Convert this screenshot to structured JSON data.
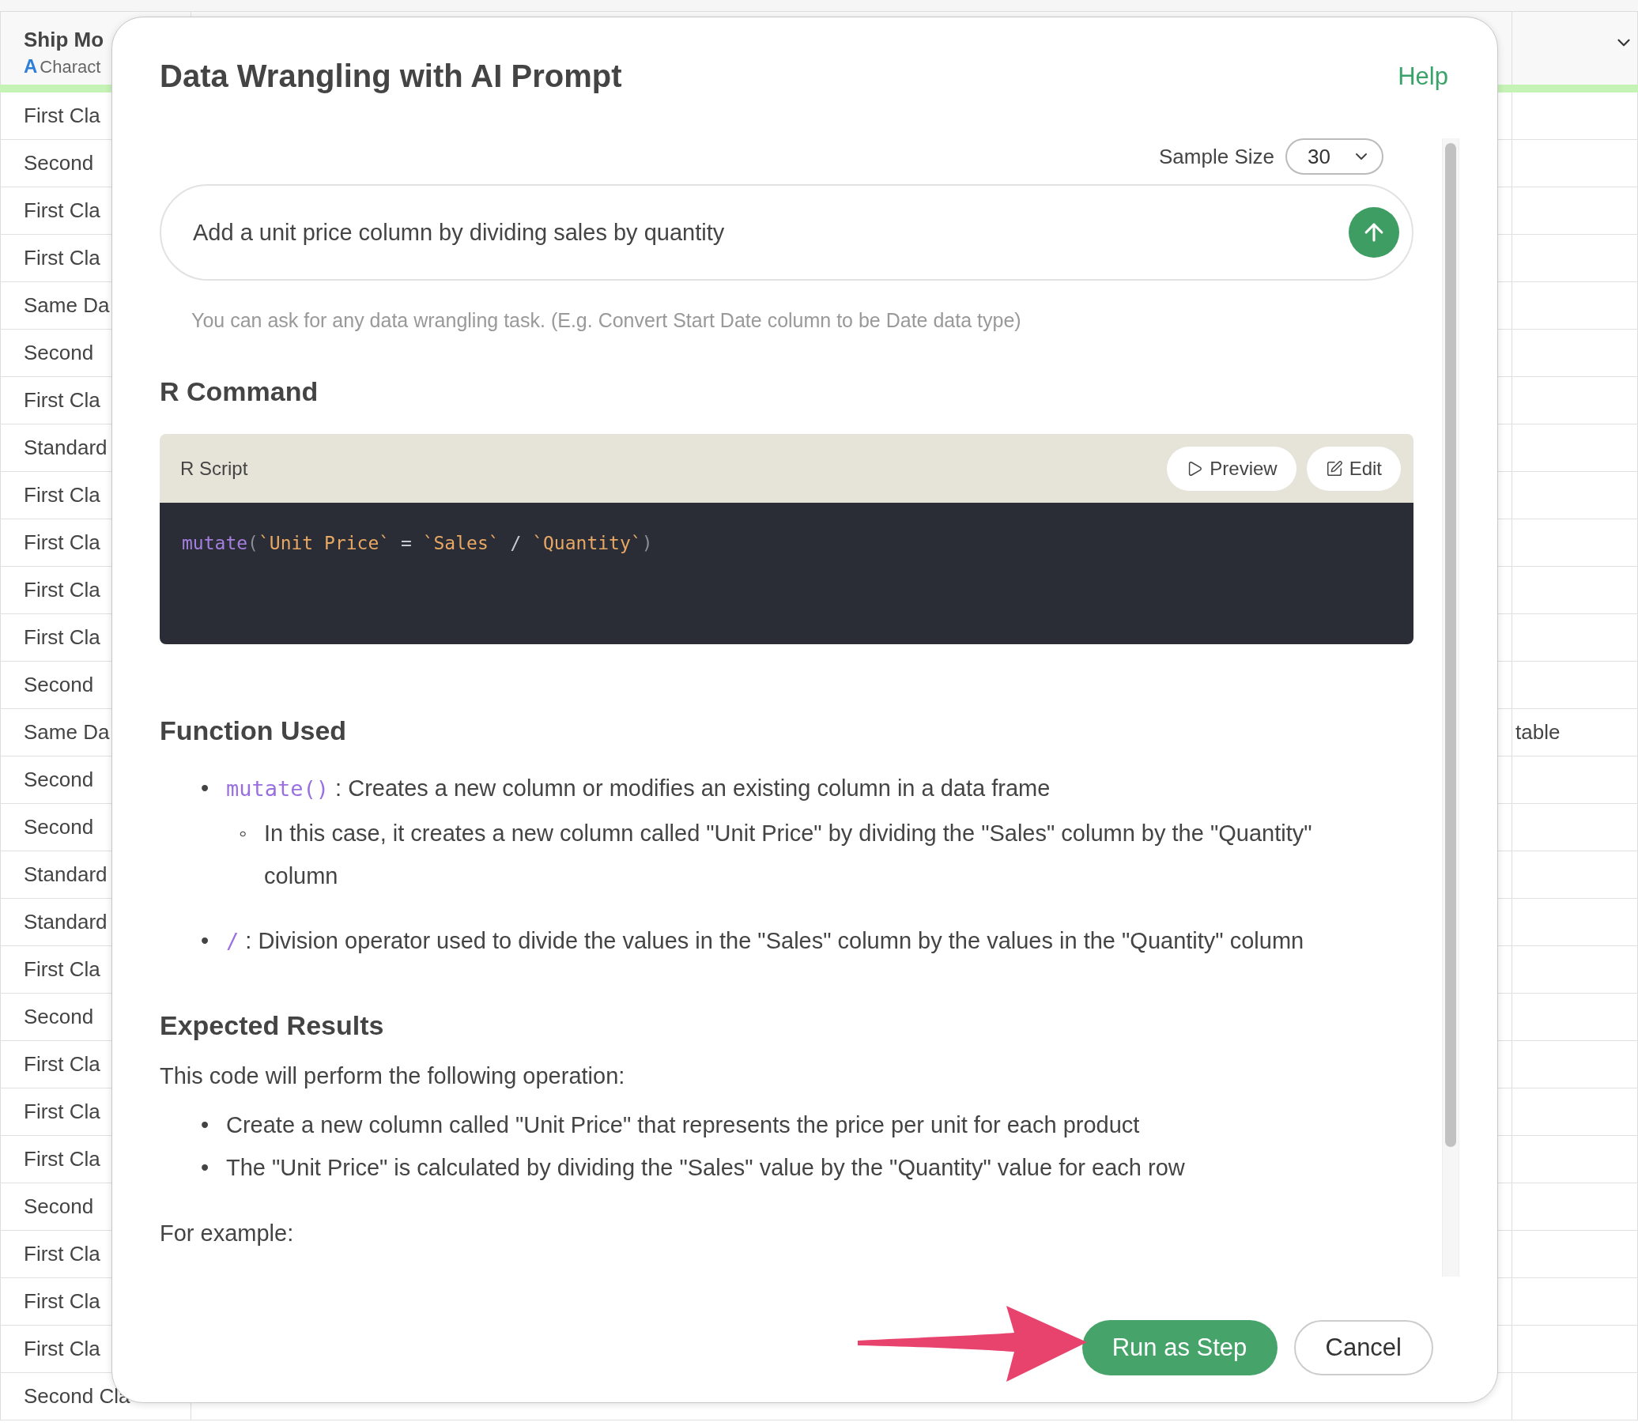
{
  "table": {
    "header": {
      "title": "Ship Mo",
      "type_icon": "A",
      "type_label": "Charact"
    },
    "rows": [
      {
        "ship_mode": "First Cla"
      },
      {
        "ship_mode": "Second"
      },
      {
        "ship_mode": "First Cla"
      },
      {
        "ship_mode": "First Cla"
      },
      {
        "ship_mode": "Same Da"
      },
      {
        "ship_mode": "Second"
      },
      {
        "ship_mode": "First Cla"
      },
      {
        "ship_mode": "Standard"
      },
      {
        "ship_mode": "First Cla"
      },
      {
        "ship_mode": "First Cla"
      },
      {
        "ship_mode": "First Cla"
      },
      {
        "ship_mode": "First Cla"
      },
      {
        "ship_mode": "Second"
      },
      {
        "ship_mode": "Same Da",
        "column_right": "table"
      },
      {
        "ship_mode": "Second"
      },
      {
        "ship_mode": "Second"
      },
      {
        "ship_mode": "Standard"
      },
      {
        "ship_mode": "Standard"
      },
      {
        "ship_mode": "First Cla"
      },
      {
        "ship_mode": "Second"
      },
      {
        "ship_mode": "First Cla"
      },
      {
        "ship_mode": "First Cla"
      },
      {
        "ship_mode": "First Cla"
      },
      {
        "ship_mode": "Second"
      },
      {
        "ship_mode": "First Cla"
      },
      {
        "ship_mode": "First Cla"
      },
      {
        "ship_mode": "First Cla"
      },
      {
        "ship_mode": "Second Cla"
      }
    ]
  },
  "dialog": {
    "title": "Data Wrangling with AI Prompt",
    "help": "Help",
    "sample_size": {
      "label": "Sample Size",
      "value": "30"
    },
    "prompt": {
      "value": "Add a unit price column by dividing sales by quantity"
    },
    "hint": "You can ask for any data wrangling task. (E.g. Convert Start Date column to be Date data type)",
    "r_command": {
      "heading": "R Command",
      "script_label": "R Script",
      "buttons": [
        {
          "kind": "preview",
          "label": "Preview"
        },
        {
          "kind": "edit",
          "label": "Edit"
        }
      ],
      "code": [
        {
          "kind": "function",
          "text": "mutate"
        },
        {
          "kind": "punct",
          "text": "("
        },
        {
          "kind": "string",
          "text": "`Unit Price`"
        },
        {
          "kind": "operator",
          "text": " = "
        },
        {
          "kind": "string",
          "text": "`Sales`"
        },
        {
          "kind": "operator",
          "text": " / "
        },
        {
          "kind": "string",
          "text": "`Quantity`"
        },
        {
          "kind": "punct",
          "text": ")"
        }
      ]
    },
    "function_used": {
      "heading": "Function Used",
      "items": [
        {
          "marker": "•",
          "code": "mutate()",
          "text": " : Creates a new column or modifies an existing column in a data frame",
          "children": [
            {
              "marker": "◦",
              "text": "In this case, it creates a new column called \"Unit Price\" by dividing the \"Sales\" column by the \"Quantity\" column"
            }
          ]
        },
        {
          "marker": "•",
          "code": "/",
          "text": " : Division operator used to divide the values in the \"Sales\" column by the values in the \"Quantity\" column"
        }
      ]
    },
    "expected_results": {
      "heading": "Expected Results",
      "intro": "This code will perform the following operation:",
      "items": [
        {
          "marker": "•",
          "text": "Create a new column called \"Unit Price\" that represents the price per unit for each product"
        },
        {
          "marker": "•",
          "text": "The \"Unit Price\" is calculated by dividing the \"Sales\" value by the \"Quantity\" value for each row"
        }
      ],
      "example": "For example:"
    },
    "buttons": [
      {
        "kind": "primary",
        "label": "Run as Step"
      },
      {
        "kind": "secondary",
        "label": "Cancel"
      }
    ]
  }
}
